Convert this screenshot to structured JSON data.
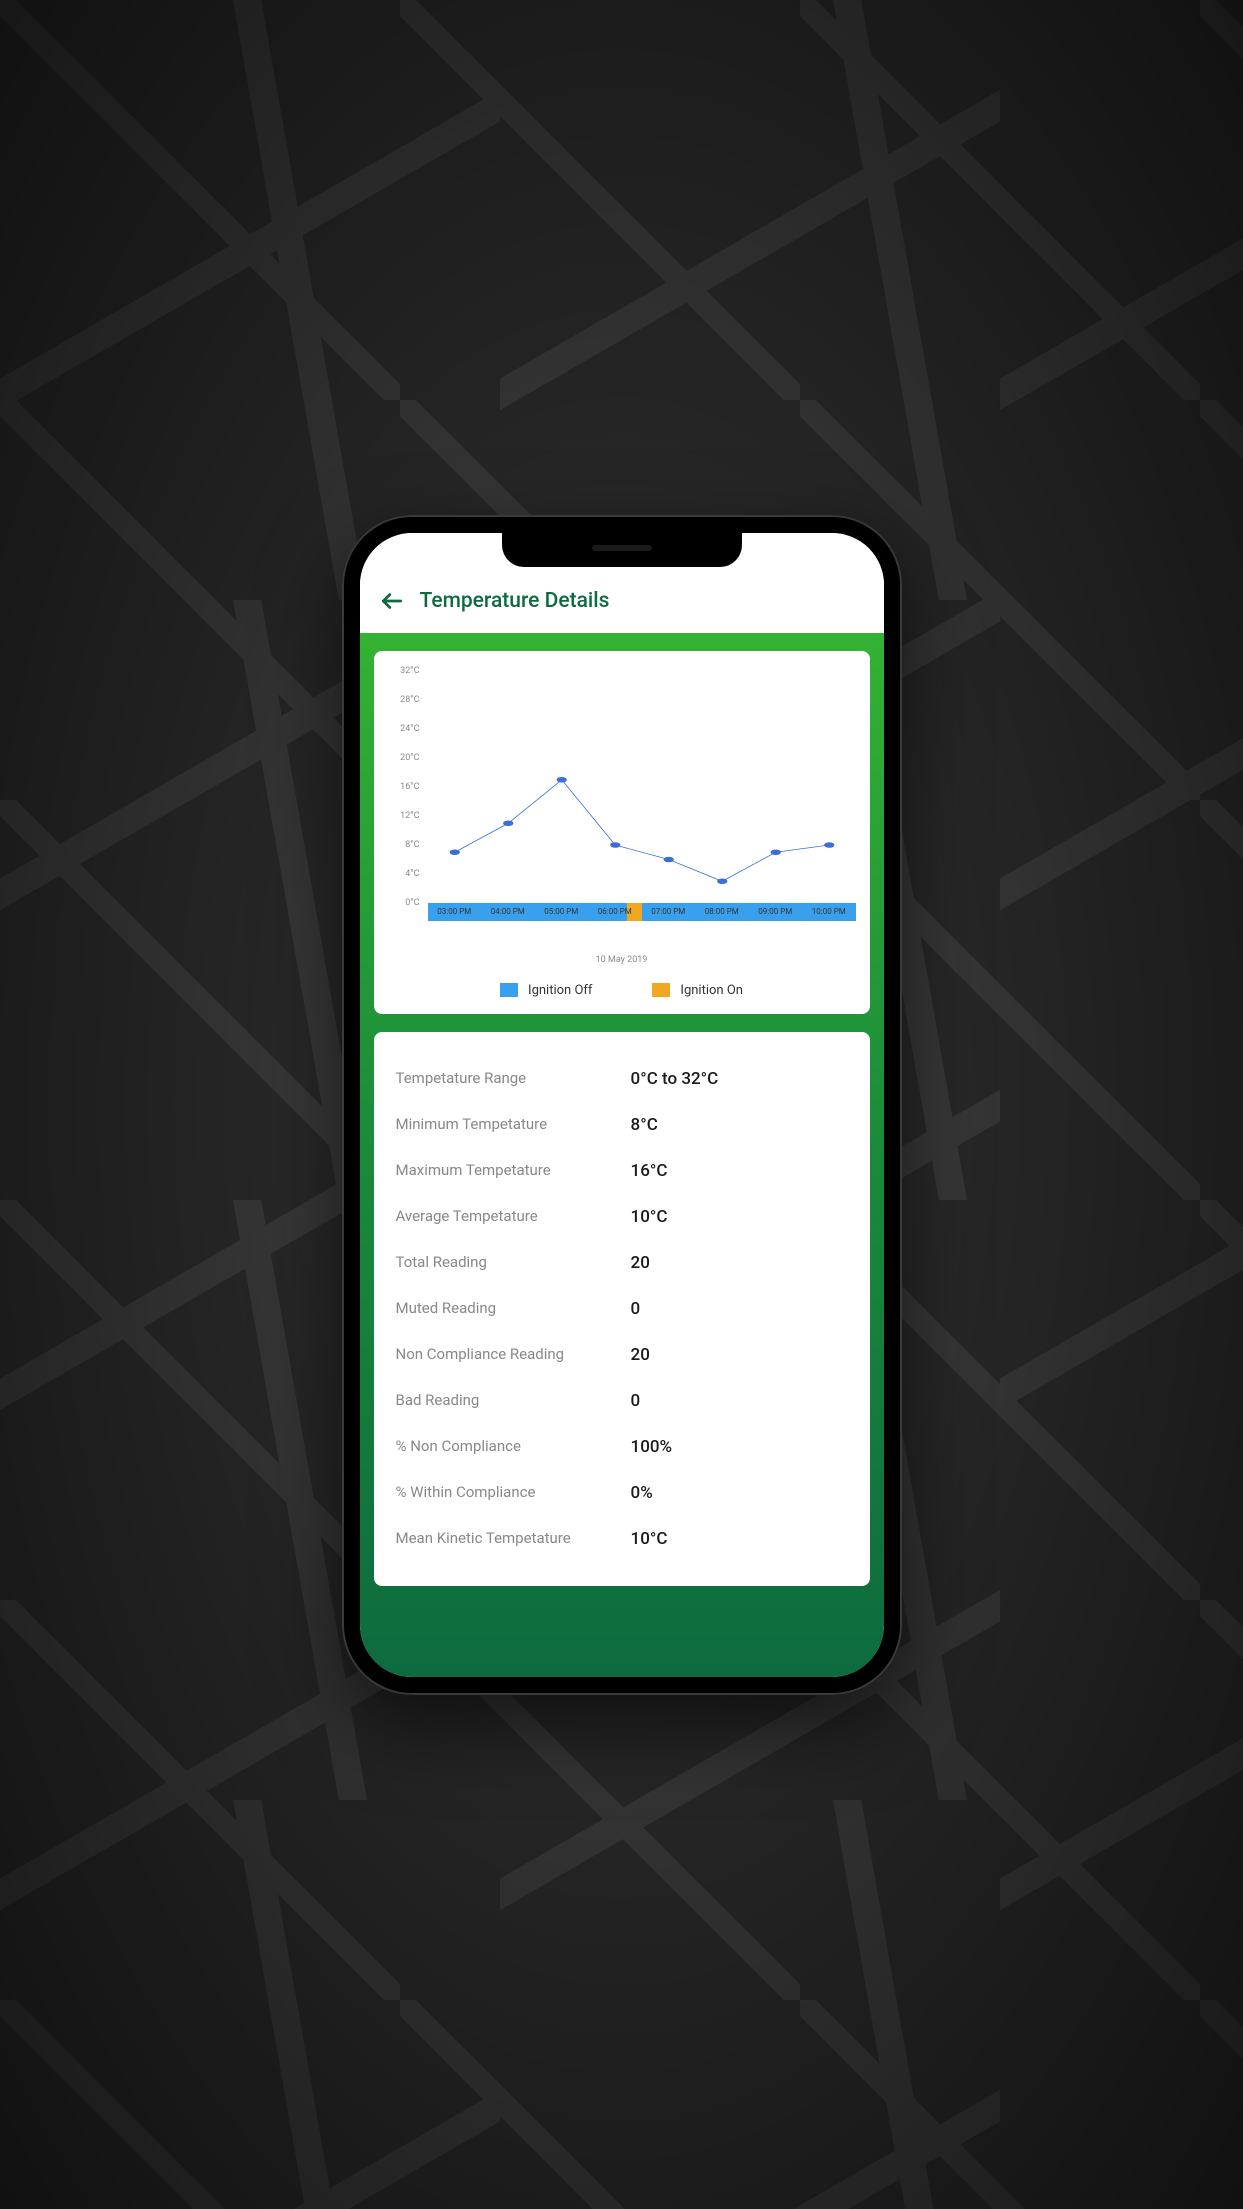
{
  "header": {
    "title": "Temperature Details"
  },
  "chart_data": {
    "type": "line",
    "categories": [
      "03:00 PM",
      "04:00 PM",
      "05:00 PM",
      "06:00 PM",
      "07:00 PM",
      "08:00 PM",
      "09:00 PM",
      "10:00 PM"
    ],
    "values": [
      7,
      11,
      17,
      8,
      6,
      3,
      7,
      8
    ],
    "title": "",
    "xlabel": "",
    "ylabel": "",
    "ylim": [
      0,
      32
    ],
    "yticks": [
      "32°C",
      "28°C",
      "24°C",
      "20°C",
      "16°C",
      "12°C",
      "8°C",
      "4°C",
      "0°C"
    ],
    "date": "10 May 2019",
    "series_color": "#3a6fd8",
    "ignition_segments": [
      {
        "index": 0,
        "state": "off"
      },
      {
        "index": 1,
        "state": "off"
      },
      {
        "index": 2,
        "state": "off"
      },
      {
        "index": 3,
        "state": "off_on_split"
      },
      {
        "index": 4,
        "state": "off"
      },
      {
        "index": 5,
        "state": "off"
      },
      {
        "index": 6,
        "state": "off"
      },
      {
        "index": 7,
        "state": "off"
      }
    ]
  },
  "legend": {
    "off": {
      "label": "Ignition Off",
      "color": "#39a0ed"
    },
    "on": {
      "label": "Ignition On",
      "color": "#f0a820"
    }
  },
  "stats": [
    {
      "label": "Tempetature Range",
      "value": "0°C to 32°C"
    },
    {
      "label": "Minimum Tempetature",
      "value": "8°C"
    },
    {
      "label": "Maximum Tempetature",
      "value": "16°C"
    },
    {
      "label": "Average Tempetature",
      "value": "10°C"
    },
    {
      "label": "Total Reading",
      "value": "20"
    },
    {
      "label": "Muted Reading",
      "value": "0"
    },
    {
      "label": "Non Compliance Reading",
      "value": "20"
    },
    {
      "label": "Bad Reading",
      "value": "0"
    },
    {
      "label": "% Non Compliance",
      "value": "100%"
    },
    {
      "label": "% Within Compliance",
      "value": "0%"
    },
    {
      "label": "Mean Kinetic Tempetature",
      "value": "10°C"
    }
  ]
}
